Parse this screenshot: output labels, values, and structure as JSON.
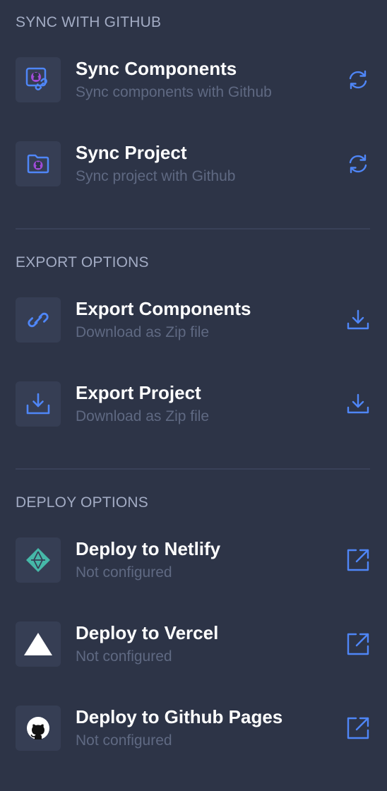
{
  "sections": [
    {
      "title": "SYNC WITH GITHUB",
      "items": [
        {
          "title": "Sync Components",
          "subtitle": "Sync components with Github",
          "icon": "github-link-icon",
          "action_icon": "sync-icon"
        },
        {
          "title": "Sync Project",
          "subtitle": "Sync project with Github",
          "icon": "github-folder-icon",
          "action_icon": "sync-icon"
        }
      ]
    },
    {
      "title": "EXPORT OPTIONS",
      "items": [
        {
          "title": "Export Components",
          "subtitle": "Download as Zip file",
          "icon": "link-icon",
          "action_icon": "download-icon"
        },
        {
          "title": "Export Project",
          "subtitle": "Download as Zip file",
          "icon": "download-tray-icon",
          "action_icon": "download-icon"
        }
      ]
    },
    {
      "title": "DEPLOY OPTIONS",
      "items": [
        {
          "title": "Deploy to Netlify",
          "subtitle": "Not configured",
          "icon": "netlify-icon",
          "action_icon": "external-link-icon"
        },
        {
          "title": "Deploy to Vercel",
          "subtitle": "Not configured",
          "icon": "vercel-icon",
          "action_icon": "external-link-icon"
        },
        {
          "title": "Deploy to Github Pages",
          "subtitle": "Not configured",
          "icon": "github-icon",
          "action_icon": "external-link-icon"
        }
      ]
    }
  ],
  "colors": {
    "background": "#2d3447",
    "tile": "#363e54",
    "accent_blue": "#4f86f7",
    "github_purple": "#a04bd8",
    "netlify_teal": "#46b8a8"
  }
}
